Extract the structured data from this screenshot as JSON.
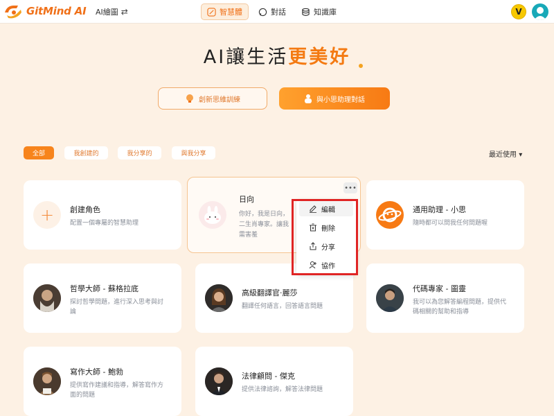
{
  "app": {
    "name": "GitMind AI",
    "vip_badge": "V"
  },
  "header": {
    "ai_draw_label": "AI繪圖",
    "ai_draw_switch": "⇄",
    "nav": [
      {
        "label": "智慧體",
        "active": true
      },
      {
        "label": "對話",
        "active": false
      },
      {
        "label": "知識庫",
        "active": false
      }
    ]
  },
  "hero": {
    "title_prefix": "AI讓生活",
    "title_highlight": "更美好"
  },
  "actions": {
    "train": "創新思維訓練",
    "chat": "與小思助理對話"
  },
  "filters": [
    "全部",
    "我創建的",
    "我分享的",
    "與我分享"
  ],
  "active_filter": "全部",
  "sort": {
    "label": "最近使用",
    "arrow": "▾"
  },
  "cards": {
    "create": {
      "icon": "+",
      "title": "創建角色",
      "desc": "配置一個專屬的智慧助理"
    },
    "rixiang": {
      "title": "日向",
      "desc_lines": [
        "你好，我是日向，",
        "二生肖專家。讓我",
        "需害羞"
      ],
      "more": "•••"
    },
    "assistant": {
      "title": "通用助理 - 小思",
      "desc": "隨時都可以問我任何問題喔"
    },
    "philosopher": {
      "title": "哲學大師 - 蘇格拉底",
      "desc_lines": [
        "探討哲學問題，進行深入思考與討",
        "論"
      ]
    },
    "translator": {
      "title": "高級翻譯官·麗莎",
      "desc": "翻譯任何語言，回答語言問題"
    },
    "coder": {
      "title": "代碼專家 - 圖靈",
      "desc_lines": [
        "我可以為您解答編程問題，提供代",
        "碼相關的幫助和指導"
      ]
    },
    "writer": {
      "title": "寫作大師 - 鮑勃",
      "desc_lines": [
        "提供寫作建議和指導，解答寫作方",
        "面的問題"
      ]
    },
    "lawyer": {
      "title": "法律顧問 - 傑克",
      "desc": "提供法律諮詢，解答法律問題"
    }
  },
  "context_menu": {
    "items": [
      {
        "label": "編輯",
        "icon": "edit-icon",
        "hover": true
      },
      {
        "label": "刪除",
        "icon": "trash-icon",
        "hover": false
      },
      {
        "label": "分享",
        "icon": "share-icon",
        "hover": false
      },
      {
        "label": "協作",
        "icon": "collaborate-icon",
        "hover": false
      }
    ]
  },
  "colors": {
    "accent": "#f77a14",
    "background": "#fdf1e4",
    "highlight_box": "#e02424"
  }
}
